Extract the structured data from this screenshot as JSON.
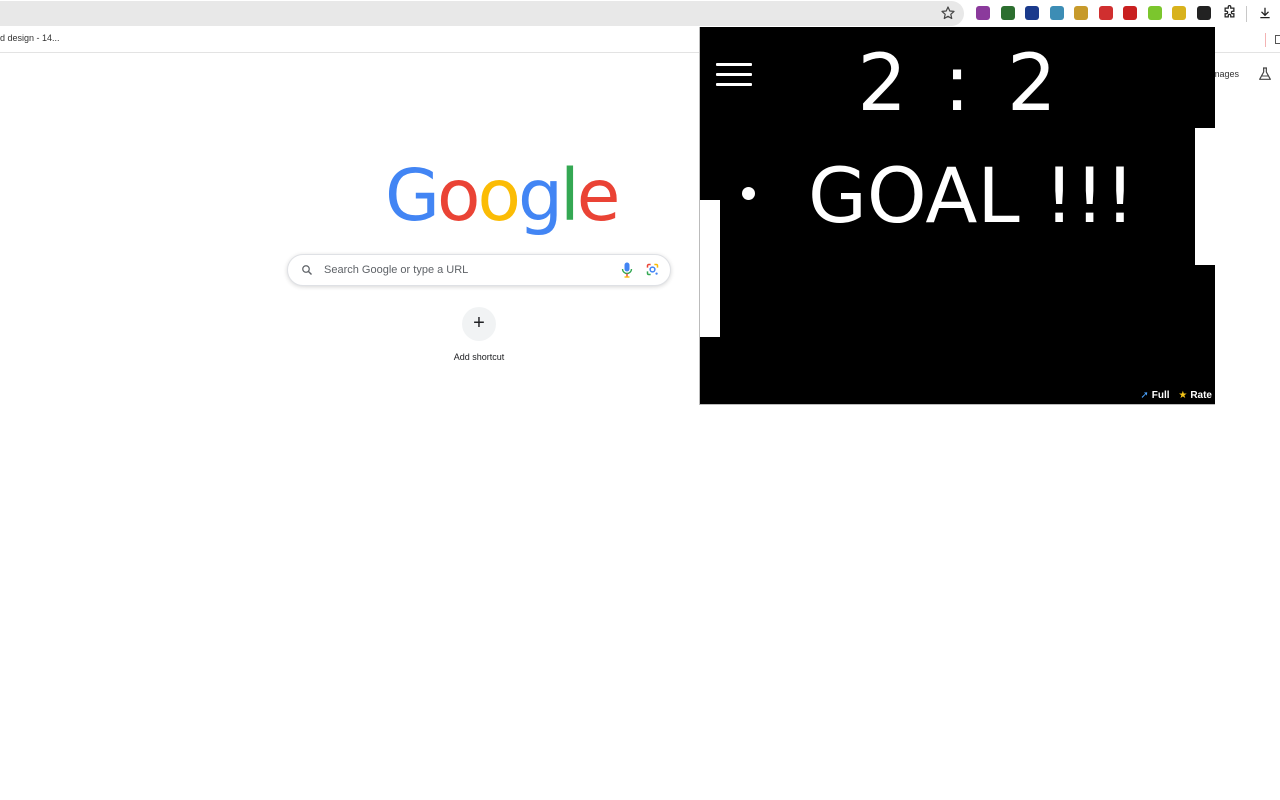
{
  "browser": {
    "bookmark_label": "d design - 14...",
    "ntp_images_label": "mages"
  },
  "extensions": [
    {
      "name": "ext-icon-1",
      "color": "#8b3a9c"
    },
    {
      "name": "ext-icon-2",
      "color": "#2c6e2f"
    },
    {
      "name": "ext-icon-3",
      "color": "#1a3a8c"
    },
    {
      "name": "ext-icon-4",
      "color": "#3c8db5"
    },
    {
      "name": "ext-icon-5",
      "color": "#c79a2b"
    },
    {
      "name": "ext-icon-6",
      "color": "#d02f2f"
    },
    {
      "name": "ext-icon-7",
      "color": "#c92020"
    },
    {
      "name": "ext-icon-8",
      "color": "#7bc62d"
    },
    {
      "name": "ext-icon-9",
      "color": "#d8b21c"
    },
    {
      "name": "ext-icon-10",
      "color": "#222222"
    }
  ],
  "ntp": {
    "logo_text": "Google",
    "logo_colors": [
      "#4285F4",
      "#EA4335",
      "#FBBC05",
      "#4285F4",
      "#34A853",
      "#EA4335"
    ],
    "search_placeholder": "Search Google or type a URL",
    "add_shortcut_label": "Add shortcut",
    "plus_glyph": "+"
  },
  "game": {
    "score_left": "2",
    "score_sep": ":",
    "score_right": "2",
    "message": "GOAL !!!",
    "full_label": "Full",
    "rate_label": "Rate",
    "background": "#000000",
    "foreground": "#ffffff"
  }
}
